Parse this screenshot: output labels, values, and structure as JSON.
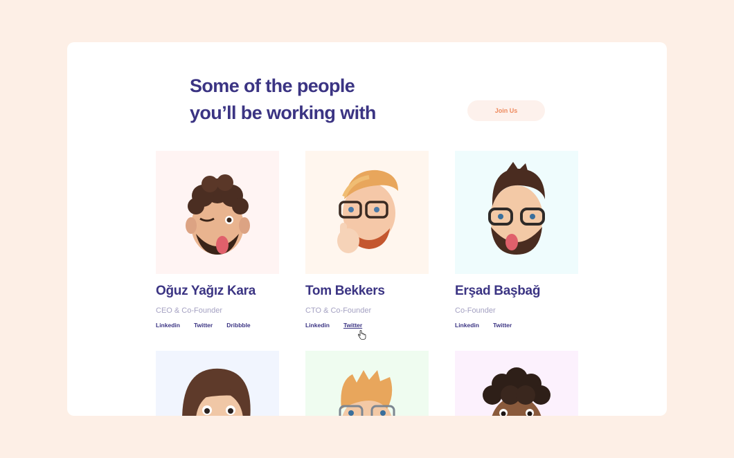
{
  "heading": {
    "line1": "Some of the people",
    "line2": "you’ll be working with"
  },
  "join_button": {
    "label": "Join Us"
  },
  "team": [
    {
      "name": "Oğuz Yağız Kara",
      "role": "CEO & Co-Founder",
      "bg": "#fff4f3",
      "links": [
        "Linkedin",
        "Twitter",
        "Dribbble"
      ]
    },
    {
      "name": "Tom Bekkers",
      "role": "CTO & Co-Founder",
      "bg": "#fff6ee",
      "links": [
        "Linkedin",
        "Twitter"
      ]
    },
    {
      "name": "Erşad Başbağ",
      "role": "Co-Founder",
      "bg": "#effcfd",
      "links": [
        "Linkedin",
        "Twitter"
      ]
    },
    {
      "bg": "#f1f5fe"
    },
    {
      "bg": "#effcf0"
    },
    {
      "bg": "#fcf1fd"
    }
  ],
  "colors": {
    "page_bg": "#fdefe6",
    "heading": "#3b3483",
    "accent": "#ee8a5e",
    "muted": "#a4a1c2"
  }
}
